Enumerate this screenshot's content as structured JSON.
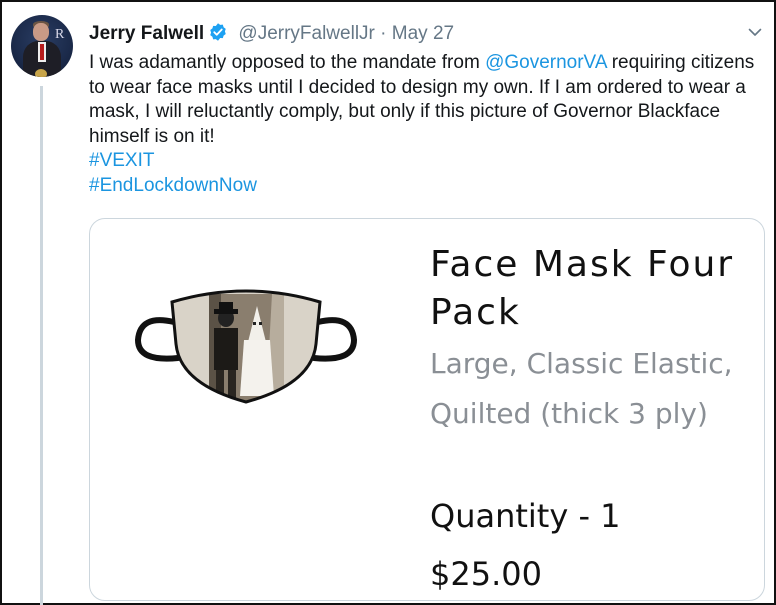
{
  "tweet": {
    "author_name": "Jerry Falwell",
    "handle": "@JerryFalwellJr",
    "separator": "·",
    "date": "May 27",
    "text_lines": [
      {
        "before": "I was adamantly opposed to the mandate from ",
        "mention": "@GovernorVA",
        "after": " requiring citizens"
      },
      "to wear face masks until I decided to design my own. If I am ordered to wear a",
      "mask, I will reluctantly comply, but only if this picture of Governor Blackface",
      "himself is on it!"
    ],
    "hashtags": [
      "#VEXIT",
      "#EndLockdownNow"
    ]
  },
  "avatar_letter": "R",
  "card": {
    "title_line1": "Face Mask Four",
    "title_line2": "Pack",
    "subtitle_line1": "Large, Classic Elastic,",
    "subtitle_line2": "Quilted (thick 3 ply)",
    "quantity": "Quantity - 1",
    "price": "$25.00"
  },
  "colors": {
    "link": "#1b95e0",
    "secondary_text": "#657786",
    "verified_badge": "#1da1f2",
    "card_border": "#ccd6dd"
  },
  "icons": [
    "verified-badge-icon",
    "caret-down-icon"
  ]
}
